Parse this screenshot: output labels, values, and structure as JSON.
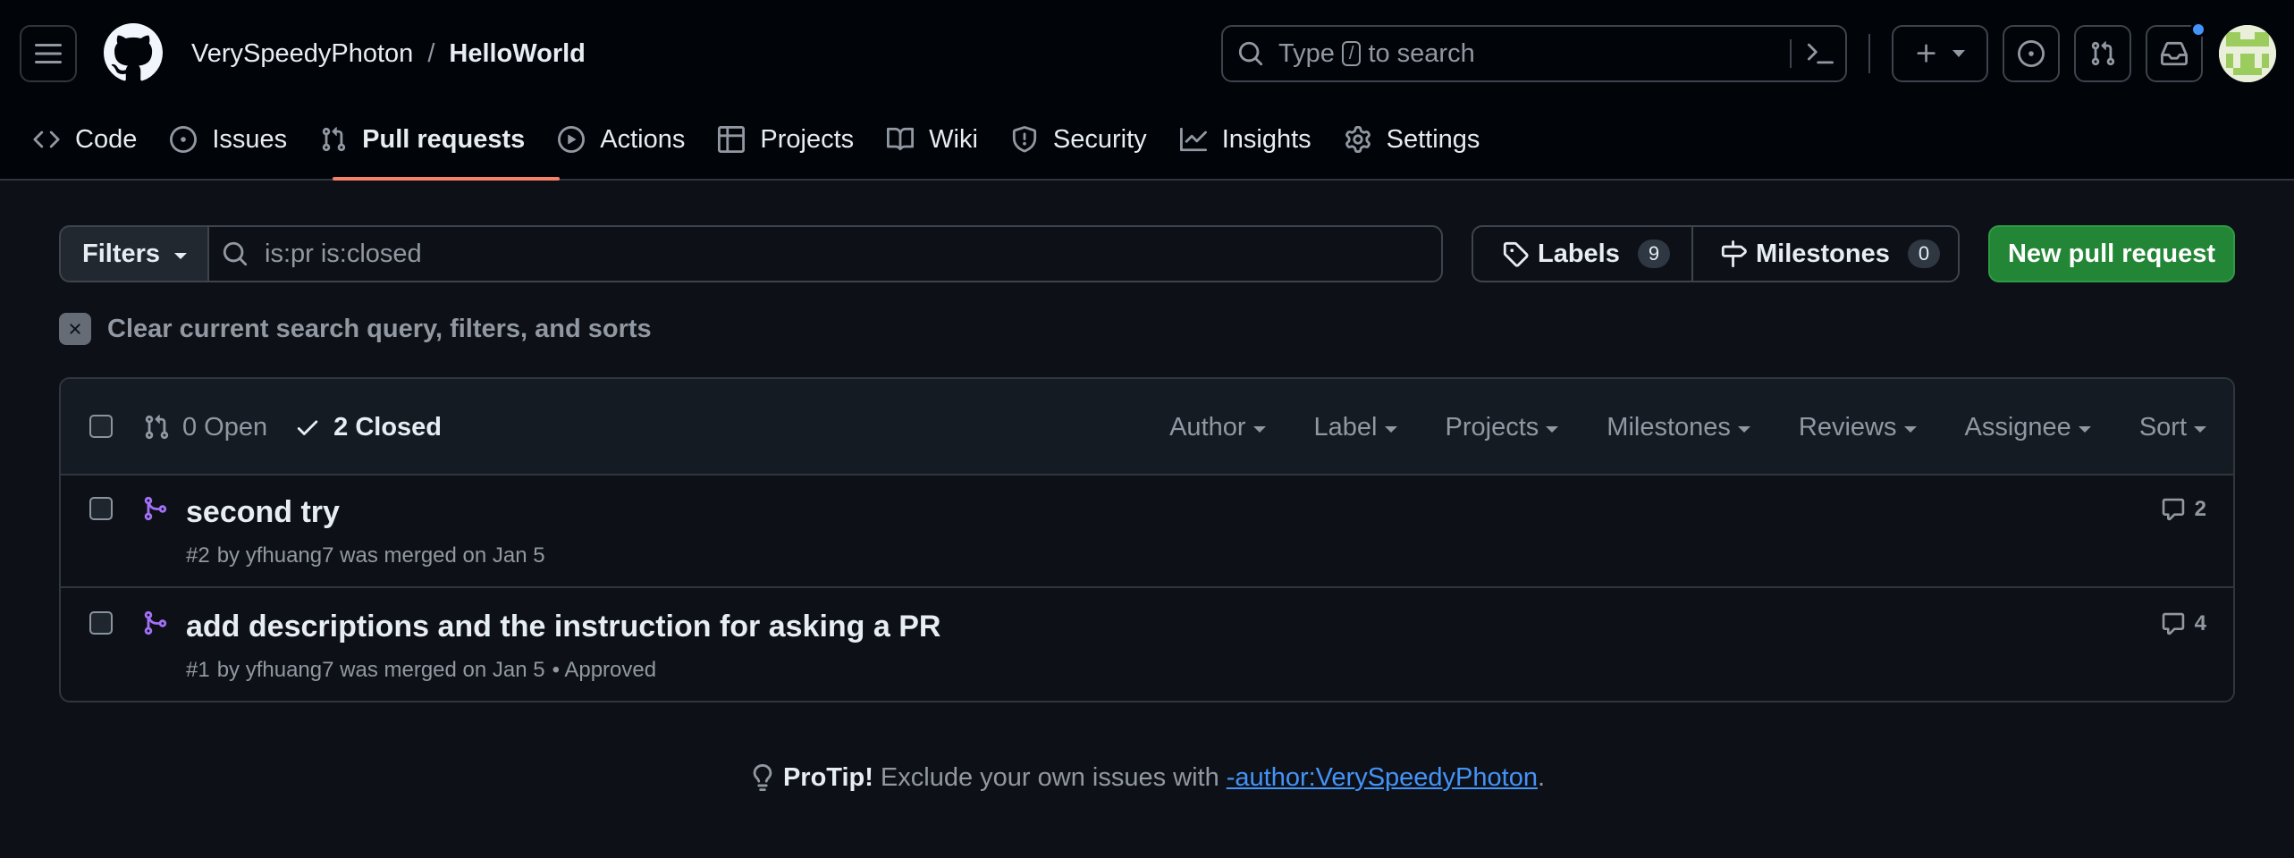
{
  "header": {
    "owner": "VerySpeedyPhoton",
    "separator": "/",
    "repo": "HelloWorld",
    "search": {
      "prefix": "Type",
      "key": "/",
      "suffix": "to search"
    }
  },
  "repo_nav": {
    "items": [
      {
        "label": "Code",
        "icon": "code-icon"
      },
      {
        "label": "Issues",
        "icon": "issue-opened-icon"
      },
      {
        "label": "Pull requests",
        "icon": "git-pull-request-icon",
        "selected": true
      },
      {
        "label": "Actions",
        "icon": "play-icon"
      },
      {
        "label": "Projects",
        "icon": "table-icon"
      },
      {
        "label": "Wiki",
        "icon": "book-icon"
      },
      {
        "label": "Security",
        "icon": "shield-icon"
      },
      {
        "label": "Insights",
        "icon": "graph-icon"
      },
      {
        "label": "Settings",
        "icon": "gear-icon"
      }
    ]
  },
  "toolbar": {
    "filters_label": "Filters",
    "query": "is:pr is:closed",
    "labels_label": "Labels",
    "labels_count": "9",
    "milestones_label": "Milestones",
    "milestones_count": "0",
    "new_pr_label": "New pull request",
    "clear_label": "Clear current search query, filters, and sorts"
  },
  "list_header": {
    "open_label": "0 Open",
    "closed_label": "2 Closed",
    "menus": [
      "Author",
      "Label",
      "Projects",
      "Milestones",
      "Reviews",
      "Assignee",
      "Sort"
    ]
  },
  "pull_requests": [
    {
      "title": "second try",
      "number": "#2",
      "meta": "by yfhuang7 was merged on Jan 5",
      "status": "",
      "comments": "2"
    },
    {
      "title": "add descriptions and the instruction for asking a PR",
      "number": "#1",
      "meta": "by yfhuang7 was merged on Jan 5",
      "status": "• Approved",
      "comments": "4"
    }
  ],
  "protip": {
    "lead": "ProTip!",
    "text": "Exclude your own issues with",
    "link": "-author:VerySpeedyPhoton",
    "end": "."
  },
  "colors": {
    "background": "#0d1117",
    "header_bg": "#010409",
    "accent_underline": "#f78166",
    "merged": "#a371f7",
    "primary_button": "#238636",
    "link": "#4493f8"
  }
}
